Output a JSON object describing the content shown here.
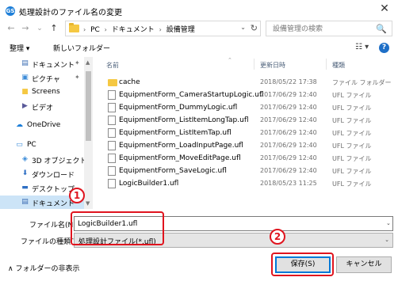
{
  "window": {
    "title": "処理設計のファイル名の変更",
    "icon": "gs-app-icon",
    "close_glyph": "✕"
  },
  "address_bar": {
    "back_glyph": "←",
    "forward_glyph": "→",
    "recent_glyph": "⌄",
    "up_glyph": "↑",
    "breadcrumbs": [
      "PC",
      "ドキュメント",
      "設備管理"
    ],
    "separator": "›",
    "dropdown_glyph": "⌄",
    "refresh_glyph": "↻"
  },
  "search": {
    "placeholder": "設備管理の検索",
    "icon_glyph": "🔍"
  },
  "toolbar": {
    "organize_label": "整理 ▾",
    "new_folder_label": "新しいフォルダー",
    "view_glyph": "☷ ▾",
    "help_glyph": "?"
  },
  "nav": {
    "items": [
      {
        "label": "ドキュメント",
        "icon": "documents-icon",
        "glyph": "▤",
        "color": "#3b6db3",
        "pinned": true
      },
      {
        "label": "ピクチャ",
        "icon": "pictures-icon",
        "glyph": "▣",
        "color": "#3b8bd8",
        "pinned": true
      },
      {
        "label": "Screens",
        "icon": "folder-icon",
        "glyph": "■",
        "color": "#f5c842",
        "pinned": false
      },
      {
        "label": "ビデオ",
        "icon": "videos-icon",
        "glyph": "▶",
        "color": "#5a5a9a",
        "pinned": false
      },
      {
        "label": "OneDrive",
        "icon": "onedrive-icon",
        "glyph": "☁",
        "color": "#1e7fd8",
        "pinned": false
      },
      {
        "label": "PC",
        "icon": "pc-icon",
        "glyph": "▭",
        "color": "#3b8bd8",
        "pinned": false
      },
      {
        "label": "3D オブジェクト",
        "icon": "3d-objects-icon",
        "glyph": "◈",
        "color": "#3b8bd8",
        "pinned": false
      },
      {
        "label": "ダウンロード",
        "icon": "downloads-icon",
        "glyph": "⬇",
        "color": "#2f6fc4",
        "pinned": false
      },
      {
        "label": "デスクトップ",
        "icon": "desktop-icon",
        "glyph": "▬",
        "color": "#2f6fc4",
        "pinned": false
      },
      {
        "label": "ドキュメント",
        "icon": "documents-icon",
        "glyph": "▤",
        "color": "#3b6db3",
        "pinned": false
      }
    ],
    "pin_glyph": "📌"
  },
  "filelist": {
    "columns": {
      "name": "名前",
      "date": "更新日時",
      "type": "種類"
    },
    "sort_glyph": "⌃",
    "rows": [
      {
        "name": "cache",
        "date": "2018/05/22 17:38",
        "type": "ファイル フォルダー",
        "kind": "folder"
      },
      {
        "name": "EquipmentForm_CameraStartupLogic.ufl",
        "date": "2017/06/29 12:40",
        "type": "UFL ファイル",
        "kind": "file"
      },
      {
        "name": "EquipmentForm_DummyLogic.ufl",
        "date": "2017/06/29 12:40",
        "type": "UFL ファイル",
        "kind": "file"
      },
      {
        "name": "EquipmentForm_ListItemLongTap.ufl",
        "date": "2017/06/29 12:40",
        "type": "UFL ファイル",
        "kind": "file"
      },
      {
        "name": "EquipmentForm_ListItemTap.ufl",
        "date": "2017/06/29 12:40",
        "type": "UFL ファイル",
        "kind": "file"
      },
      {
        "name": "EquipmentForm_LoadInputPage.ufl",
        "date": "2017/06/29 12:40",
        "type": "UFL ファイル",
        "kind": "file"
      },
      {
        "name": "EquipmentForm_MoveEditPage.ufl",
        "date": "2017/06/29 12:40",
        "type": "UFL ファイル",
        "kind": "file"
      },
      {
        "name": "EquipmentForm_SaveLogic.ufl",
        "date": "2017/06/29 12:40",
        "type": "UFL ファイル",
        "kind": "file"
      },
      {
        "name": "LogicBuilder1.ufl",
        "date": "2018/05/23 11:25",
        "type": "UFL ファイル",
        "kind": "file"
      }
    ]
  },
  "filename": {
    "label": "ファイル名(N):",
    "value": "LogicBuilder1.ufl",
    "dropdown_glyph": "⌄"
  },
  "filetype": {
    "label": "ファイルの種類(T):",
    "value": "処理設計ファイル(*.ufl)",
    "dropdown_glyph": "⌄"
  },
  "footer": {
    "hide_folders_label": "∧ フォルダーの非表示",
    "save_label": "保存(S)",
    "cancel_label": "キャンセル"
  },
  "annotations": {
    "marker1": "1",
    "marker2": "2",
    "color": "#e0141e"
  }
}
